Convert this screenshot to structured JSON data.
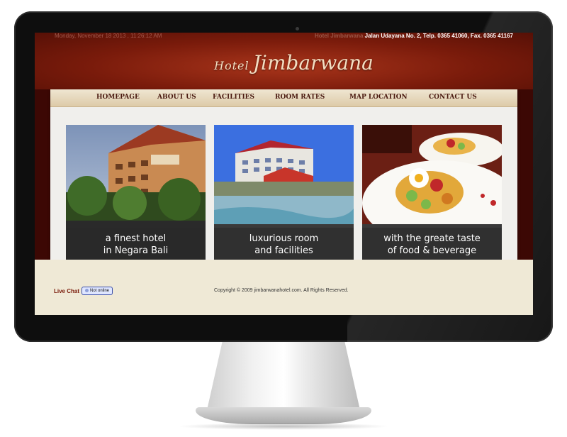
{
  "top_bar": {
    "datetime": "Monday, November 18 2013 , 11:26:12 AM",
    "hotel_name": "Hotel Jimbarwana",
    "address": "Jalan Udayana No. 2, Telp. 0365 41060, Fax. 0365 41167"
  },
  "logo": {
    "small": "Hotel",
    "big": "Jimbarwana"
  },
  "nav": {
    "homepage": "HOMEPAGE",
    "about_us": "ABOUT US",
    "facilities": "FACILITIES",
    "room_rates": "ROOM RATES",
    "map_location": "MAP LOCATION",
    "contact_us": "CONTACT US"
  },
  "tiles": [
    {
      "line1": "a finest hotel",
      "line2": "in Negara Bali"
    },
    {
      "line1": "luxurious room",
      "line2": "and facilities"
    },
    {
      "line1": "with the greate taste",
      "line2": "of food & beverage"
    }
  ],
  "footer": {
    "live_chat": "Live Chat",
    "chat_status": "Not online",
    "copyright": "Copyright © 2009 jimbarwanahotel.com. All Rights Reserved."
  },
  "colors": {
    "header_red": "#7a1b0b",
    "page_dark": "#3c0804",
    "panel": "#f0efec",
    "nav": "#ddcaa8",
    "footer": "#efe9d6"
  }
}
